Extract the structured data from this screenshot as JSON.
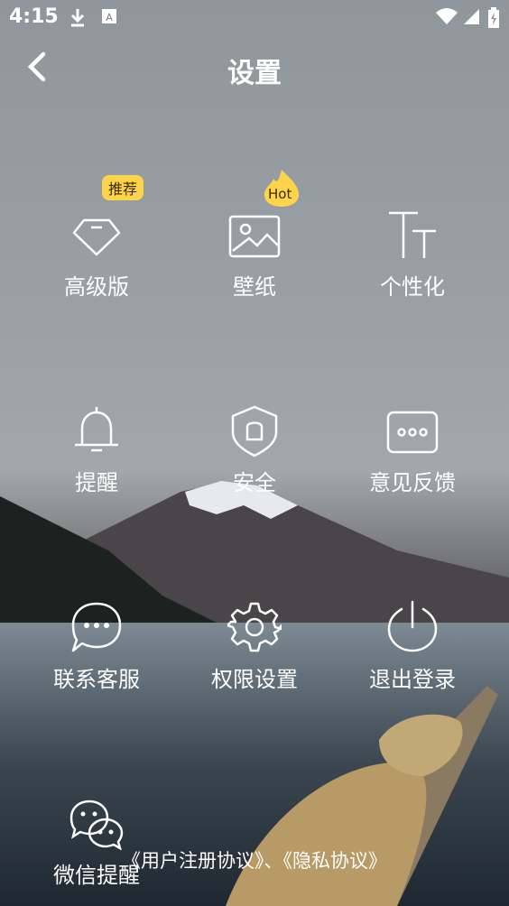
{
  "status_bar": {
    "time": "4:15"
  },
  "header": {
    "title": "设置"
  },
  "items": [
    {
      "label": "高级版",
      "icon": "diamond-icon",
      "badge": "推荐"
    },
    {
      "label": "壁纸",
      "icon": "wallpaper-icon",
      "badge": "Hot"
    },
    {
      "label": "个性化",
      "icon": "text-style-icon"
    },
    {
      "label": "提醒",
      "icon": "bell-icon"
    },
    {
      "label": "安全",
      "icon": "shield-icon"
    },
    {
      "label": "意见反馈",
      "icon": "feedback-icon"
    },
    {
      "label": "联系客服",
      "icon": "chat-icon"
    },
    {
      "label": "权限设置",
      "icon": "gear-icon"
    },
    {
      "label": "退出登录",
      "icon": "power-icon"
    },
    {
      "label": "微信提醒",
      "icon": "wechat-icon"
    }
  ],
  "footer": {
    "text": "《用户注册协议》、《隐私协议》"
  },
  "colors": {
    "badge": "#ffd34a",
    "text": "#ffffff"
  }
}
